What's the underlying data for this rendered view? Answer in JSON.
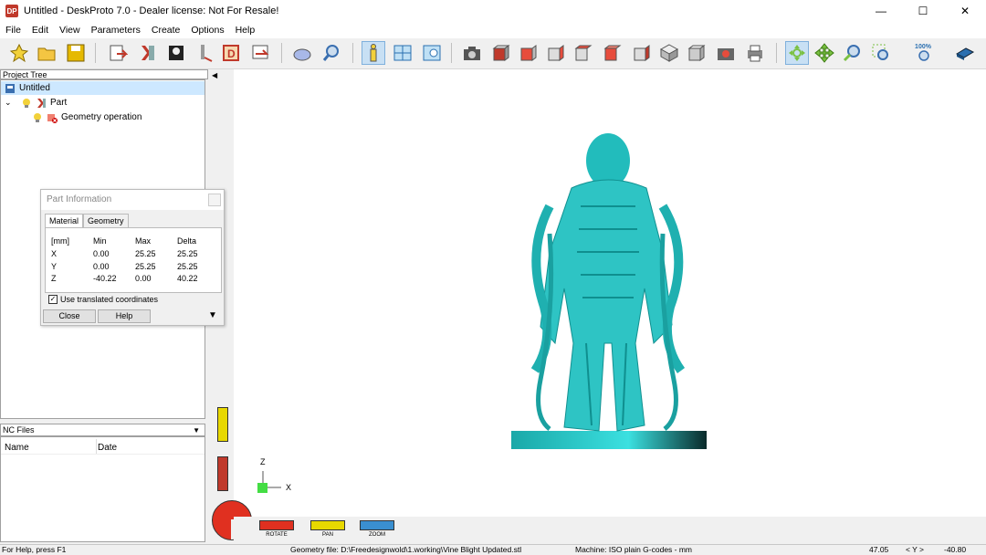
{
  "window": {
    "title": "Untitled - DeskProto 7.0 - Dealer license: Not For Resale!",
    "icon_text": "DP"
  },
  "window_controls": {
    "minimize": "—",
    "maximize": "☐",
    "close": "✕"
  },
  "menu": [
    "File",
    "Edit",
    "View",
    "Parameters",
    "Create",
    "Options",
    "Help"
  ],
  "toolbar": {
    "zoom_label": "100%"
  },
  "project_tree": {
    "header": "Project Tree",
    "items": [
      {
        "label": "Untitled",
        "level": 0
      },
      {
        "label": "Part",
        "level": 1
      },
      {
        "label": "Geometry operation",
        "level": 2
      }
    ]
  },
  "nc_files": {
    "header": "NC Files",
    "columns": [
      "Name",
      "Date"
    ]
  },
  "part_info": {
    "title": "Part Information",
    "tabs": [
      "Material",
      "Geometry"
    ],
    "headers": [
      "[mm]",
      "Min",
      "Max",
      "Delta"
    ],
    "rows": [
      [
        "X",
        "0.00",
        "25.25",
        "25.25"
      ],
      [
        "Y",
        "0.00",
        "25.25",
        "25.25"
      ],
      [
        "Z",
        "-40.22",
        "0.00",
        "40.22"
      ]
    ],
    "checkbox_label": "Use translated coordinates",
    "close_label": "Close",
    "help_label": "Help"
  },
  "axes": {
    "z": "Z",
    "x": "X"
  },
  "mouse_modes": [
    "ROTATE",
    "PAN",
    "ZOOM"
  ],
  "status": {
    "help": "For Help, press F1",
    "geometry": "Geometry file: D:\\Freedesignwold\\1.working\\Vine Blight Updated.stl",
    "machine": "Machine: ISO plain G-codes - mm",
    "x": "47.05",
    "y_label": "< Y >",
    "y": "-40.80"
  },
  "colors": {
    "model": "#2ec4c4",
    "selection": "#cde8ff"
  }
}
